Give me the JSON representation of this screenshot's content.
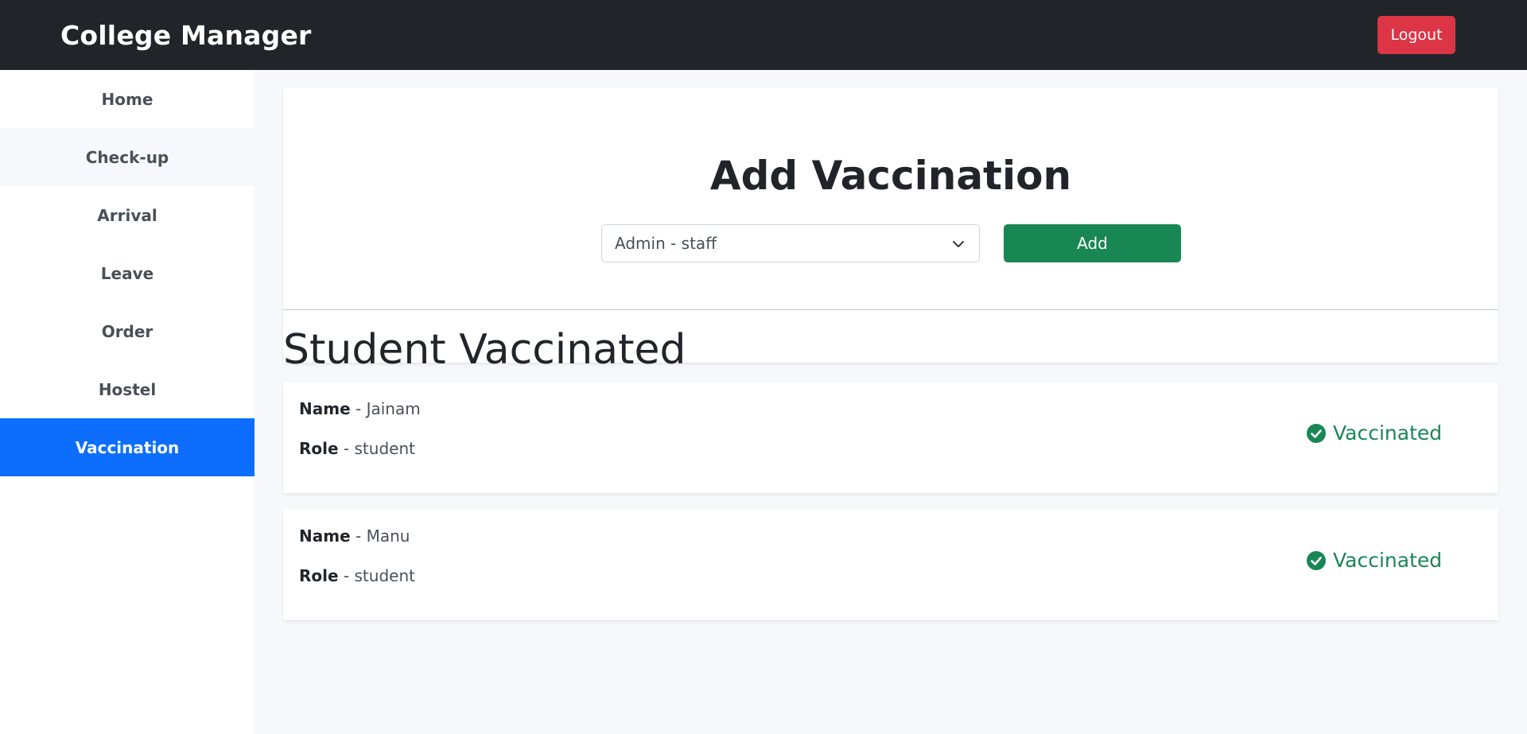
{
  "navbar": {
    "brand": "College Manager",
    "logout_label": "Logout"
  },
  "sidebar": {
    "items": [
      {
        "label": "Home"
      },
      {
        "label": "Check-up"
      },
      {
        "label": "Arrival"
      },
      {
        "label": "Leave"
      },
      {
        "label": "Order"
      },
      {
        "label": "Hostel"
      },
      {
        "label": "Vaccination"
      }
    ],
    "active": "Vaccination"
  },
  "add_vaccination": {
    "title": "Add Vaccination",
    "select_value": "Admin - staff",
    "add_label": "Add"
  },
  "vaccinated": {
    "title": "Student Vaccinated",
    "name_label": "Name",
    "role_label": "Role",
    "entries": [
      {
        "name": "Jainam",
        "role": "student",
        "status": "Vaccinated"
      },
      {
        "name": "Manu",
        "role": "student",
        "status": "Vaccinated"
      }
    ]
  },
  "colors": {
    "navbar_bg": "#212529",
    "logout": "#dc3545",
    "active_sidebar": "#0d6efd",
    "add_button": "#198754",
    "status_green": "#198754"
  },
  "icons": {
    "dropdown": "chevron-down-icon",
    "status": "check-circle-icon"
  }
}
